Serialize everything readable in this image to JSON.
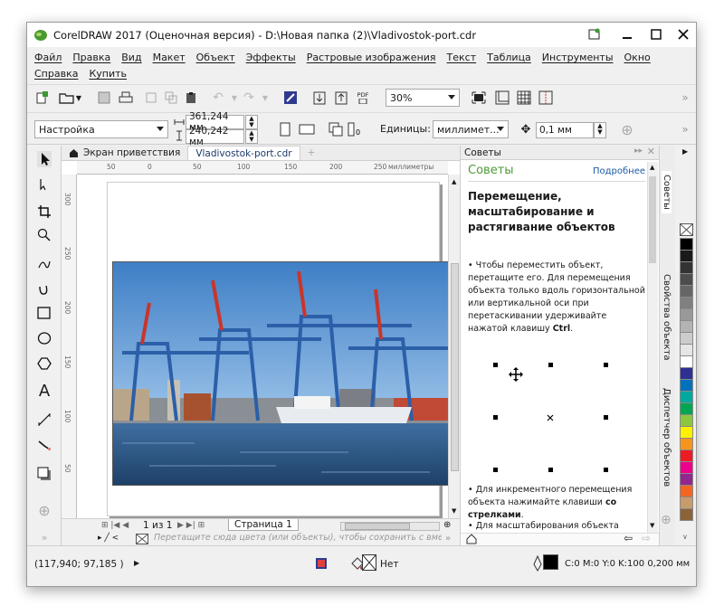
{
  "window": {
    "title": "CorelDRAW 2017 (Оценочная версия) - D:\\Новая папка (2)\\Vladivostok-port.cdr"
  },
  "menu": {
    "row1": [
      "Файл",
      "Правка",
      "Вид",
      "Макет",
      "Объект",
      "Эффекты",
      "Растровые изображения",
      "Текст",
      "Таблица",
      "Инструменты",
      "Окно"
    ],
    "row2": [
      "Справка",
      "Купить"
    ]
  },
  "toolbar1": {
    "zoom": "30%",
    "pdf_label": "PDF"
  },
  "toolbar2": {
    "preset": "Настройка",
    "width": "361,244 мм",
    "height": "240,242 мм",
    "units_label": "Единицы:",
    "units_value": "миллимет...",
    "nudge": "0,1 мм"
  },
  "tabs": {
    "welcome": "Экран приветствия",
    "document": "Vladivostok-port.cdr"
  },
  "ruler": {
    "h_ticks": [
      "50",
      "0",
      "50",
      "100",
      "150",
      "200",
      "250"
    ],
    "h_unit": "миллиметры",
    "v_ticks": [
      "300",
      "250",
      "200",
      "150",
      "100",
      "50"
    ]
  },
  "pagenav": {
    "counter": "1 из 1",
    "page_tab": "Страница 1",
    "drop_hint": "Перетащите сюда цвета (или объекты), чтобы сохранить с вместе с документом"
  },
  "docker": {
    "header": "Советы",
    "title": "Советы",
    "more_link": "Подробнее",
    "heading": "Перемещение, масштабирование и растягивание объектов",
    "tip1_prefix": "• Чтобы переместить объект, перетащите его. Для перемещения объекта только вдоль горизонтальной или вертикальной оси при перетаскивании удерживайте нажатой клавишу ",
    "tip1_key": "Ctrl",
    "tip2_prefix": "• Для инкрементного перемещения объекта нажимайте клавиши ",
    "tip2_key": "со стрелками",
    "tip3": "• Для масштабирования объекта перетащите один из угловых маркеров"
  },
  "sidetabs": [
    "Советы",
    "Свойства объекта",
    "Диспетчер объектов"
  ],
  "palette": {
    "colors": [
      "#000000",
      "#1a1a1a",
      "#333333",
      "#4d4d4d",
      "#666666",
      "#808080",
      "#999999",
      "#b3b3b3",
      "#cccccc",
      "#e6e6e6",
      "#ffffff",
      "#2e3192",
      "#0072bc",
      "#00a99d",
      "#00a651",
      "#8dc63f",
      "#fff200",
      "#f7941d",
      "#ed1c24",
      "#ec008c",
      "#92278f",
      "#f26522",
      "#c69c6d",
      "#8c6239"
    ]
  },
  "status": {
    "coords": "(117,940; 97,185 )",
    "fill_label": "Нет",
    "outline_label": "C:0 M:0 Y:0 K:100  0,200 мм"
  }
}
